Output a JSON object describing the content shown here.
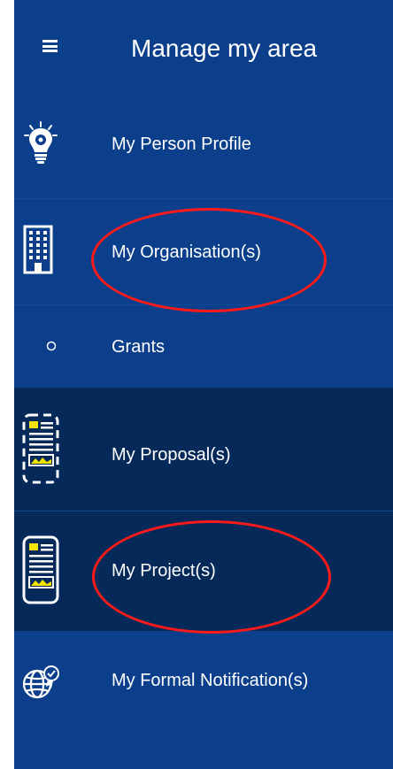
{
  "header": {
    "title": "Manage my area"
  },
  "menu": {
    "items": [
      {
        "label": "My Person Profile",
        "icon": "lightbulb-gear-icon"
      },
      {
        "label": "My Organisation(s)",
        "icon": "building-icon"
      },
      {
        "label": "Grants",
        "icon": "bullet-circle-icon"
      },
      {
        "label": "My Proposal(s)",
        "icon": "proposal-document-icon"
      },
      {
        "label": "My Project(s)",
        "icon": "project-document-icon"
      },
      {
        "label": "My Formal Notification(s)",
        "icon": "globe-certificate-icon"
      }
    ]
  },
  "colors": {
    "panel": "#0b3f8c",
    "selected": "#052a5a",
    "annotation": "#ff1a1a",
    "accent_yellow": "#f5e400"
  }
}
